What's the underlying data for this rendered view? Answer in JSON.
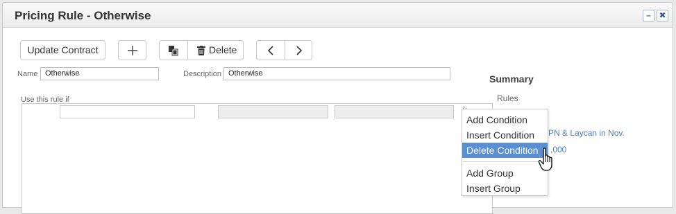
{
  "window": {
    "title": "Pricing Rule - Otherwise",
    "minimize_icon": "minimize-icon",
    "close_icon": "close-icon"
  },
  "toolbar": {
    "update_label": "Update Contract",
    "add_icon": "plus-icon",
    "copy_icon": "copy-icon",
    "delete_label": "Delete",
    "delete_icon": "trash-icon",
    "prev_icon": "chevron-left-icon",
    "next_icon": "chevron-right-icon"
  },
  "form": {
    "name_label": "Name",
    "name_value": "Otherwise",
    "description_label": "Description",
    "description_value": "Otherwise",
    "use_rule_label": "Use this rule if"
  },
  "summary": {
    "title": "Summary",
    "rules_label": "Rules",
    "rule_1": "PN & Laycan in Nov.",
    "rule_2": ",000"
  },
  "context_menu": {
    "items": [
      "Add Condition",
      "Insert Condition",
      "Delete Condition",
      "Add Group",
      "Insert Group"
    ],
    "active": "Delete Condition",
    "active_color": "#5b8fd0"
  }
}
